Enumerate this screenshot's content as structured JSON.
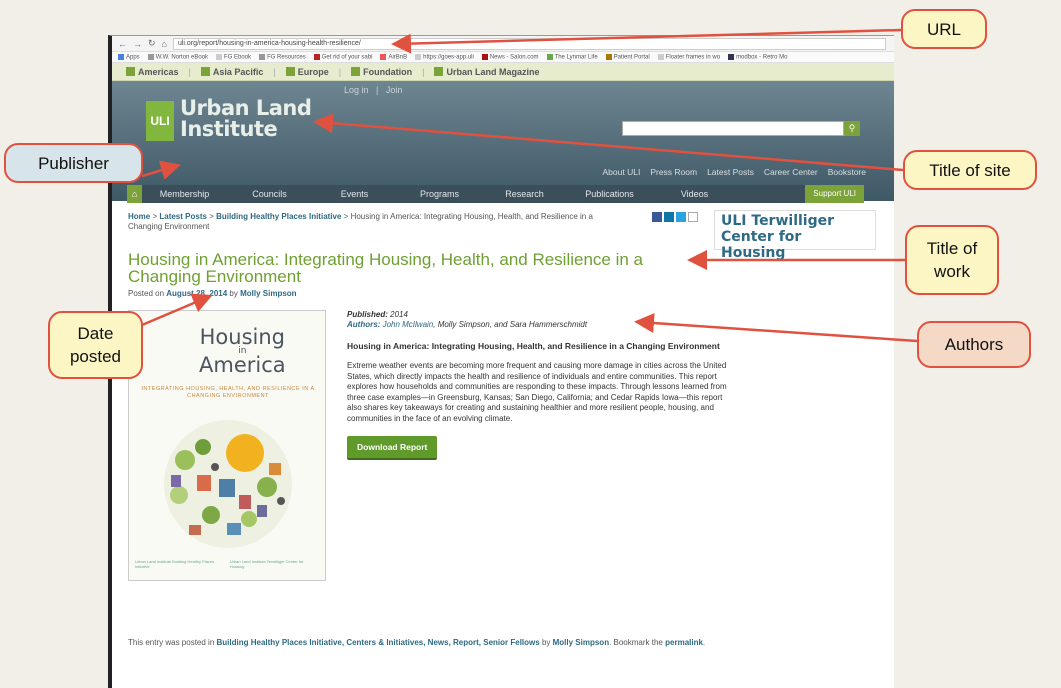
{
  "browser": {
    "url": "uli.org/report/housing-in-america-housing-health-resilience/",
    "bookmarks": [
      "Apps",
      "W.W. Norton eBook",
      "FG Ebook",
      "FG Resources",
      "Get rid of your sabi",
      "AirBnB",
      "https://goes-app.uli",
      "News - Salon.com",
      "The Lynmar Life",
      "Patient Portal",
      "Floater frames in wo",
      "modbox - Retro Mo"
    ]
  },
  "regions": [
    "Americas",
    "Asia Pacific",
    "Europe",
    "Foundation",
    "Urban Land Magazine"
  ],
  "header": {
    "login": "Log in",
    "join": "Join",
    "logo_mark": "ULI",
    "logo_line1": "Urban Land",
    "logo_line2": "Institute",
    "top_links": [
      "About ULI",
      "Press Room",
      "Latest Posts",
      "Career Center",
      "Bookstore"
    ]
  },
  "nav": {
    "items": [
      "Membership",
      "Councils",
      "Events",
      "Programs",
      "Research",
      "Publications",
      "Videos"
    ],
    "support": "Support ULI"
  },
  "breadcrumb": {
    "home": "Home",
    "latest": "Latest Posts",
    "section": "Building Healthy Places Initiative",
    "current": "> Housing in America: Integrating Housing, Health, and Resilience in a Changing Environment"
  },
  "sidebar": {
    "terwilliger_line1": "ULI Terwilliger",
    "terwilliger_line2": "Center for Housing"
  },
  "article": {
    "title": "Housing in America: Integrating Housing, Health, and Resilience in a Changing Environment",
    "posted_prefix": "Posted on",
    "posted_date": "August 28, 2014",
    "posted_by": "by",
    "posted_author": "Molly Simpson",
    "published_label": "Published:",
    "published_value": "2014",
    "authors_label": "Authors:",
    "authors_first": "John McIlwain",
    "authors_rest": ", Molly Simpson, and Sara Hammerschmidt",
    "report_heading": "Housing in America: Integrating Housing, Health, and Resilience in a Changing Environment",
    "description": "Extreme weather events are becoming more frequent and causing more damage in cities across the United States, which directly impacts the health and resilience of individuals and entire communities. This report explores how households and communities are responding to these impacts. Through lessons learned from three case examples—in Greensburg, Kansas; San Diego, California; and Cedar Rapids Iowa—this report also shares key takeaways for creating and sustaining healthier and more resilient people, housing, and communities in the face of an evolving climate.",
    "download": "Download Report"
  },
  "cover": {
    "line1": "Housing",
    "line2": "in",
    "line3": "America",
    "subtitle": "INTEGRATING HOUSING, HEALTH, AND RESILIENCE IN A CHANGING ENVIRONMENT",
    "foot_left": "Urban Land Institute  Building Healthy Places Initiative",
    "foot_right": "Urban Land Institute  Terwilliger Center for Housing"
  },
  "footer": {
    "prefix": "This entry was posted in",
    "cats": "Building Healthy Places Initiative, Centers & Initiatives, News, Report, Senior Fellows",
    "by": "by",
    "author": "Molly Simpson",
    "bookmark": ". Bookmark the",
    "permalink": "permalink"
  },
  "callouts": {
    "url": "URL",
    "title_site": "Title of site",
    "publisher": "Publisher",
    "title_work": "Title of work",
    "date_posted": "Date posted",
    "authors": "Authors"
  },
  "colors": {
    "callout_border": "#e0523f",
    "callout_yellow": "#fbf6c4",
    "callout_blue": "#d7e4ea",
    "callout_peach": "#f5d9c7",
    "uli_green": "#7ca23a",
    "title_green": "#6fa032"
  }
}
